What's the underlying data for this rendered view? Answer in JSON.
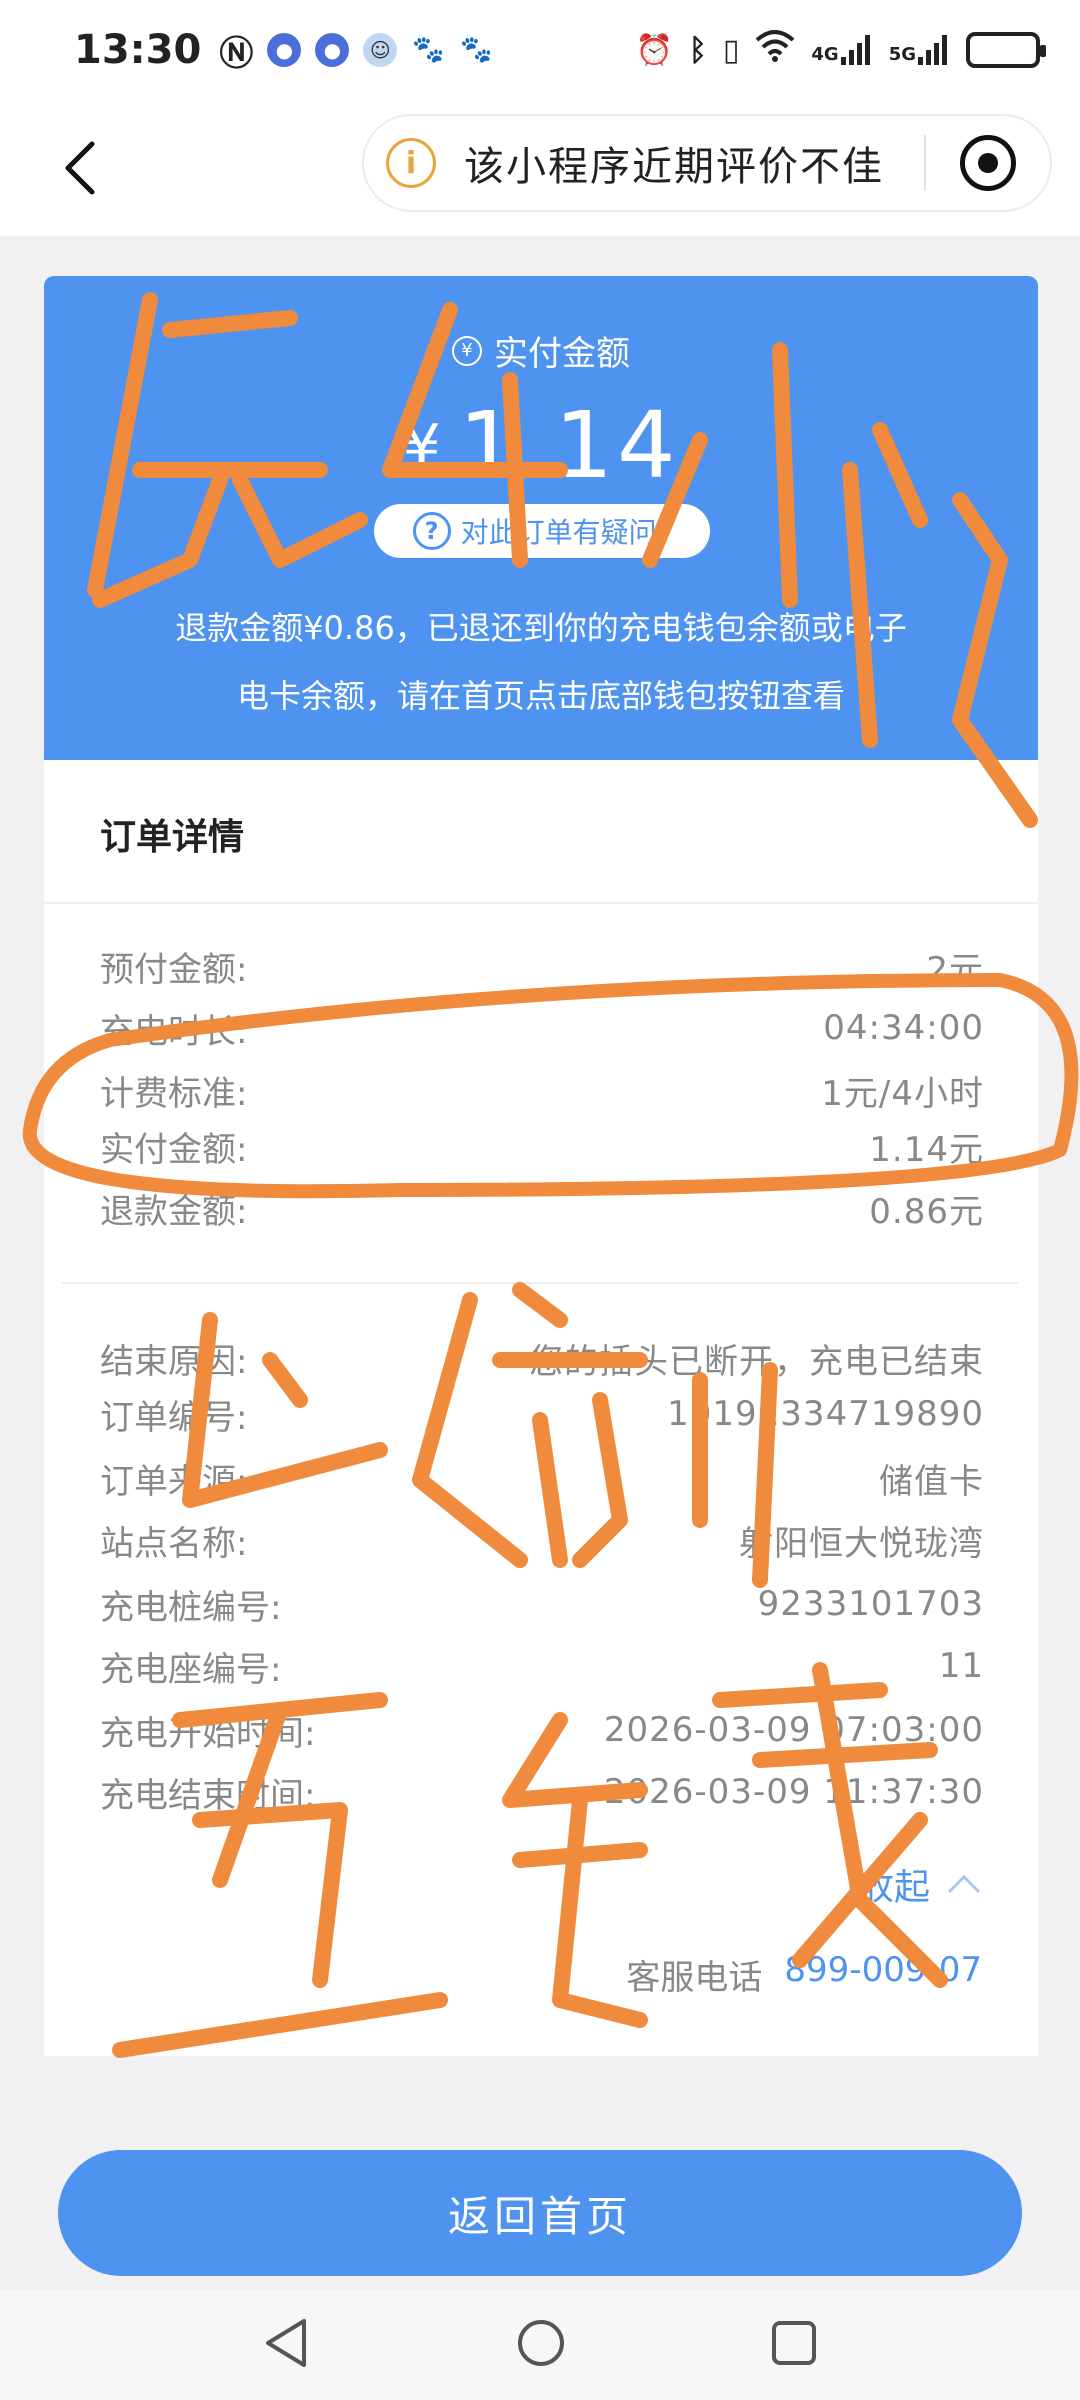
{
  "status_bar": {
    "time": "13:30",
    "network_badges": [
      "4G",
      "5G"
    ],
    "battery_level": 0.24
  },
  "nav": {
    "notice_text": "该小程序近期评价不佳"
  },
  "summary": {
    "label": "实付金额",
    "currency": "¥",
    "amount": "1.14",
    "doubt_label": "对此订单有疑问?",
    "refund_note_line1": "退款金额¥0.86，已退还到你的充电钱包余额或电子",
    "refund_note_line2": "电卡余额，请在首页点击底部钱包按钮查看"
  },
  "details": {
    "title": "订单详情",
    "rows_group1": [
      {
        "label": "预付金额:",
        "value": "2元"
      },
      {
        "label": "充电时长:",
        "value": "04:34:00"
      },
      {
        "label": "计费标准:",
        "value": "1元/4小时"
      },
      {
        "label": "实付金额:",
        "value": "1.14元"
      },
      {
        "label": "退款金额:",
        "value": "0.86元"
      }
    ],
    "rows_group2": [
      {
        "label": "结束原因:",
        "value": "您的插头已断开，充电已结束"
      },
      {
        "label": "订单编号:",
        "value": "10191334719890"
      },
      {
        "label": "订单来源:",
        "value": "储值卡"
      },
      {
        "label": "站点名称:",
        "value": "射阳恒大悦珑湾"
      },
      {
        "label": "充电桩编号:",
        "value": "9233101703"
      },
      {
        "label": "充电座编号:",
        "value": "11"
      },
      {
        "label": "充电开始时间:",
        "value": "2026-03-09 07:03:00"
      },
      {
        "label": "充电结束时间:",
        "value": "2026-03-09 11:37:30"
      }
    ],
    "collapse_label": "收起",
    "hotline_label": "客服电话",
    "hotline_number": "899-009-07"
  },
  "home_button_label": "返回首页",
  "colors": {
    "primary": "#4e93ef",
    "warning": "#e9a53a",
    "annotation": "#f08a3c"
  },
  "icons": {
    "back": "chevron-left-icon",
    "notice": "info-icon",
    "record": "record-icon",
    "amount": "coin-icon",
    "doubt": "question-icon",
    "collapse": "chevron-up-icon"
  }
}
